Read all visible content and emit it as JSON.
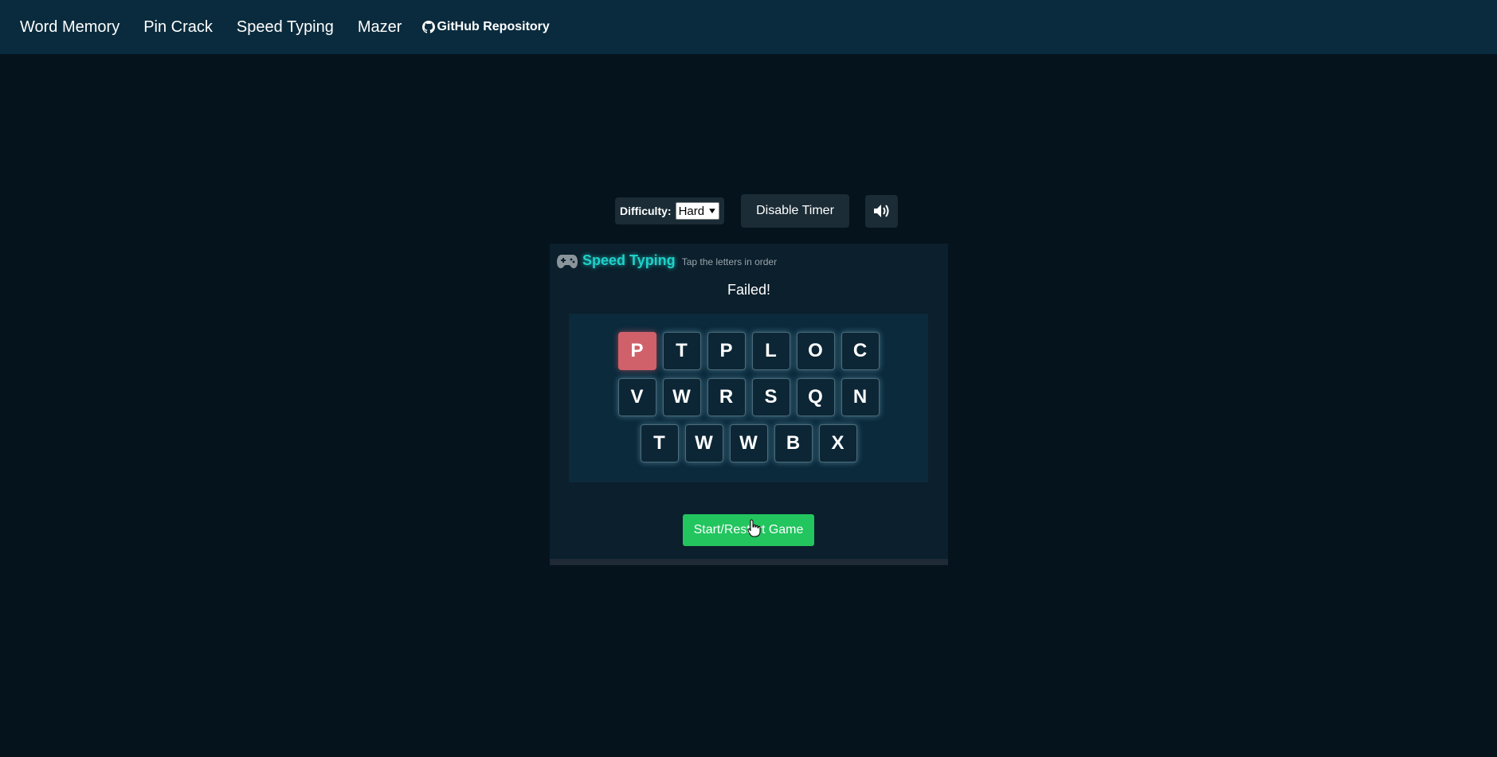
{
  "nav": {
    "links": [
      "Word Memory",
      "Pin Crack",
      "Speed Typing",
      "Mazer"
    ],
    "github_label": "GitHub Repository",
    "github_icon": "github-icon"
  },
  "controls": {
    "difficulty_label": "Difficulty:",
    "difficulty_value": "Hard",
    "timer_button": "Disable Timer",
    "sound_icon": "speaker-icon"
  },
  "game": {
    "icon": "gamepad-icon",
    "title": "Speed Typing",
    "subtitle": "Tap the letters in order",
    "status": "Failed!",
    "rows": [
      [
        "P",
        "T",
        "P",
        "L",
        "O",
        "C"
      ],
      [
        "V",
        "W",
        "R",
        "S",
        "Q",
        "N"
      ],
      [
        "T",
        "W",
        "W",
        "B",
        "X"
      ]
    ],
    "failed_tile_color": "#d0606a",
    "start_button": "Start/Restart Game"
  },
  "colors": {
    "accent": "#1fd1c9",
    "start": "#22c55e",
    "nav_bg": "#0a2b3d",
    "page_bg": "#05131d"
  }
}
